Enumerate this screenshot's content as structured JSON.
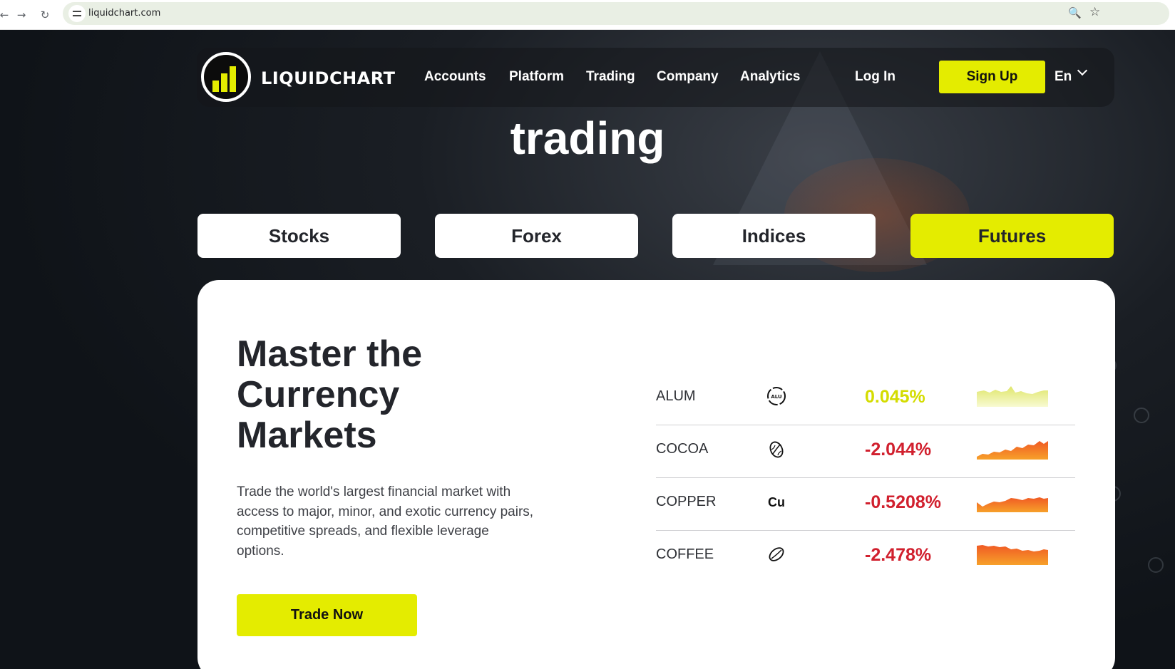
{
  "browser": {
    "url": "liquidchart.com",
    "icons": [
      "back-arrow-icon",
      "forward-arrow-icon",
      "reload-icon",
      "site-info-icon",
      "zoom-icon",
      "bookmark-star-icon"
    ]
  },
  "header": {
    "brand": "LIQUIDCHART",
    "nav": [
      "Accounts",
      "Platform",
      "Trading",
      "Company",
      "Analytics"
    ],
    "login": "Log In",
    "signup": "Sign Up",
    "language": "En"
  },
  "hero": {
    "word": "trading"
  },
  "tabs": [
    {
      "label": "Stocks",
      "active": false
    },
    {
      "label": "Forex",
      "active": false
    },
    {
      "label": "Indices",
      "active": false
    },
    {
      "label": "Futures",
      "active": true
    }
  ],
  "card": {
    "title": "Master the Currency Markets",
    "description": "Trade the world's largest financial market with access to major, minor, and exotic currency pairs, competitive spreads, and flexible leverage options.",
    "cta": "Trade Now"
  },
  "markets": [
    {
      "name": "ALUM",
      "icon": "aluminium-icon",
      "icon_text": "ALU",
      "change": "0.045%",
      "direction": "up"
    },
    {
      "name": "COCOA",
      "icon": "cocoa-bean-icon",
      "change": "-2.044%",
      "direction": "down"
    },
    {
      "name": "COPPER",
      "icon": "copper-icon",
      "icon_text": "Cu",
      "change": "-0.5208%",
      "direction": "down"
    },
    {
      "name": "COFFEE",
      "icon": "coffee-bean-icon",
      "change": "-2.478%",
      "direction": "down"
    }
  ],
  "colors": {
    "accent": "#e4ec00",
    "negative": "#d1202e",
    "positive": "#d4dc00",
    "dark": "#23252b"
  }
}
